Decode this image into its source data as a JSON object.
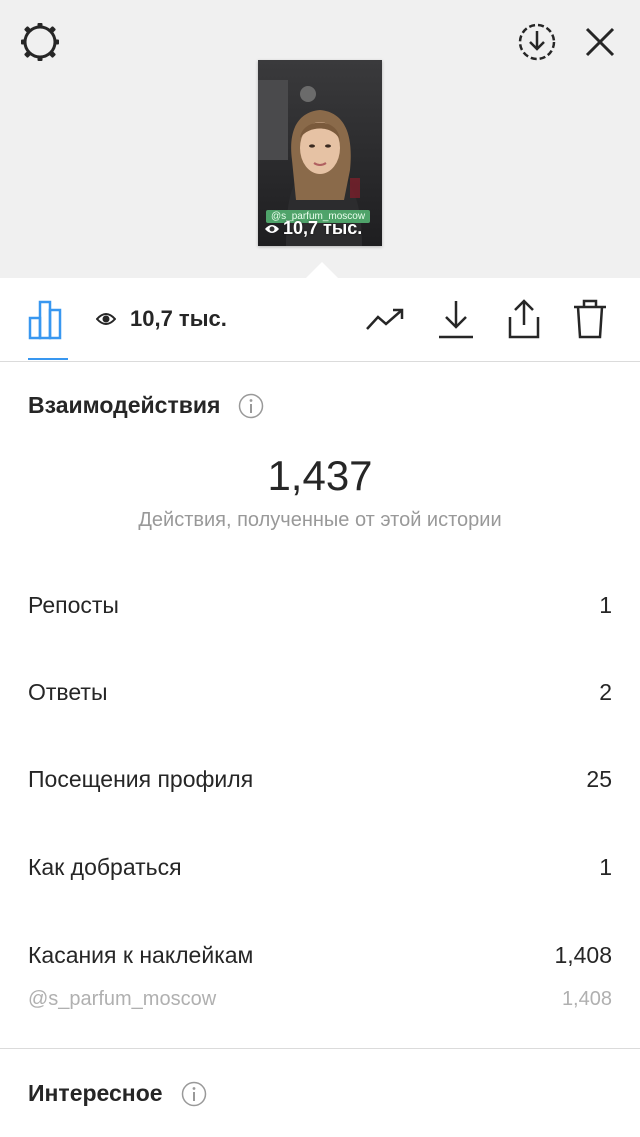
{
  "header": {
    "icons": [
      "gear-icon",
      "download-circle-icon",
      "close-icon"
    ]
  },
  "story_thumbnail": {
    "sticker_text": "@s_parfum_moscow",
    "views_overlay": "10,7 тыс."
  },
  "toolbar": {
    "views": "10,7 тыс.",
    "icons": [
      "bar-chart-icon",
      "eye-icon",
      "trend-icon",
      "download-icon",
      "share-icon",
      "trash-icon"
    ]
  },
  "interactions": {
    "title": "Взаимодействия",
    "total": "1,437",
    "caption": "Действия, полученные от этой истории",
    "rows": [
      {
        "label": "Репосты",
        "value": "1"
      },
      {
        "label": "Ответы",
        "value": "2"
      },
      {
        "label": "Посещения профиля",
        "value": "25"
      },
      {
        "label": "Как добраться",
        "value": "1"
      },
      {
        "label": "Касания к наклейкам",
        "value": "1,408"
      }
    ],
    "sticker_row": {
      "label": "@s_parfum_moscow",
      "value": "1,408"
    }
  },
  "discovery": {
    "title": "Интересное"
  },
  "colors": {
    "accent": "#3897f0",
    "text": "#262626",
    "secondary": "#999999",
    "top_background": "#f0f0f0"
  }
}
